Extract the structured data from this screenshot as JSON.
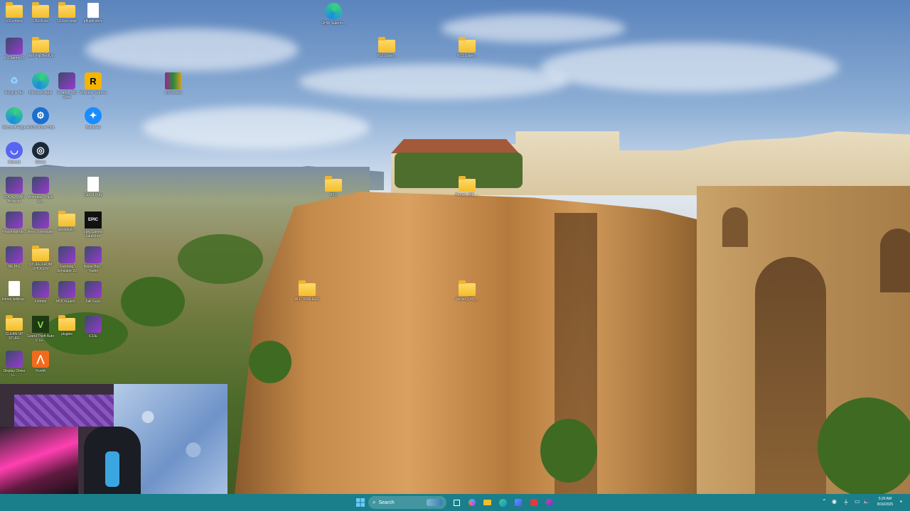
{
  "desktop": {
    "icons": [
      {
        "id": "i1",
        "label": "U1Gvnkslv",
        "kind": "folder"
      },
      {
        "id": "i2",
        "label": "U61cfcsw",
        "kind": "folder"
      },
      {
        "id": "i3",
        "label": "U13ow scipt",
        "kind": "folder"
      },
      {
        "id": "i4",
        "label": "pflugin.sbvx",
        "kind": "doc"
      },
      {
        "id": "i5",
        "label": "GHW Saterin...",
        "kind": "edge"
      },
      {
        "id": "i6",
        "label": "E-Channel 3",
        "kind": "app"
      },
      {
        "id": "i7",
        "label": "Mod Flip Bed/Up",
        "kind": "folder"
      },
      {
        "id": "i8",
        "label": "PS2 Gluen...",
        "kind": "folder"
      },
      {
        "id": "i9",
        "label": "PS3 Gluen...",
        "kind": "folder"
      },
      {
        "id": "i10",
        "label": "Recycle Bin",
        "kind": "recycle"
      },
      {
        "id": "i11",
        "label": "Microsoft Apps",
        "kind": "edge"
      },
      {
        "id": "i12",
        "label": "Smartfix 365 Store",
        "kind": "app"
      },
      {
        "id": "i13",
        "label": "Rockstar Games ...",
        "kind": "rockstar"
      },
      {
        "id": "i14",
        "label": "U1Gvnkslv",
        "kind": "winrar"
      },
      {
        "id": "i15",
        "label": "Microsoft Edge",
        "kind": "edge"
      },
      {
        "id": "i16",
        "label": "ASUS Driver Hub",
        "kind": "gear"
      },
      {
        "id": "i17",
        "label": "BattleNet",
        "kind": "battlenet"
      },
      {
        "id": "i18",
        "label": "Discord",
        "kind": "discord"
      },
      {
        "id": "i19",
        "label": "Steam",
        "kind": "steam"
      },
      {
        "id": "i20",
        "label": "LOCKDOWN Browser",
        "kind": "app"
      },
      {
        "id": "i21",
        "label": "American Truck Si...",
        "kind": "app"
      },
      {
        "id": "i22",
        "label": "Call of Duty",
        "kind": "doc"
      },
      {
        "id": "i23",
        "label": "BX2",
        "kind": "folder"
      },
      {
        "id": "i24",
        "label": "Ferrari_488_...",
        "kind": "folder"
      },
      {
        "id": "i25",
        "label": "Phasmophob...",
        "kind": "app"
      },
      {
        "id": "i26",
        "label": "Revo Uninstaller",
        "kind": "app"
      },
      {
        "id": "i27",
        "label": "derekdiph...",
        "kind": "folder"
      },
      {
        "id": "i28",
        "label": "Epic Games Launcher",
        "kind": "epic"
      },
      {
        "id": "i29",
        "label": "BE.PIG",
        "kind": "app"
      },
      {
        "id": "i30",
        "label": "STUFF FROM SHOGUN",
        "kind": "folder"
      },
      {
        "id": "i31",
        "label": "Farming Simulator 22",
        "kind": "app"
      },
      {
        "id": "i32",
        "label": "Bayer Bre... Trader",
        "kind": "app"
      },
      {
        "id": "i33",
        "label": "Inmen wildcar...",
        "kind": "doc"
      },
      {
        "id": "i34",
        "label": "Fortnite",
        "kind": "app"
      },
      {
        "id": "i35",
        "label": "MODGuard...",
        "kind": "app"
      },
      {
        "id": "i36",
        "label": "Fall Guys",
        "kind": "app"
      },
      {
        "id": "i37",
        "label": "ALL TRAILERS",
        "kind": "folder"
      },
      {
        "id": "i38",
        "label": "Ferrari_F40_...",
        "kind": "folder"
      },
      {
        "id": "i39",
        "label": "CLEAN UP STUFF",
        "kind": "folder"
      },
      {
        "id": "i40",
        "label": "Grand Theft Auto V Le...",
        "kind": "gta"
      },
      {
        "id": "i41",
        "label": "plugins",
        "kind": "folder"
      },
      {
        "id": "i42",
        "label": "iCUE",
        "kind": "app"
      },
      {
        "id": "i43",
        "label": "Display Driver U...",
        "kind": "app"
      },
      {
        "id": "i44",
        "label": "FiveM",
        "kind": "fivem"
      }
    ]
  },
  "taskbar": {
    "search_label": "Search",
    "clock_time": "5:20 AM",
    "clock_date": "8/16/2025"
  },
  "colors": {
    "taskbar": "#1a7f8a",
    "folder": "#f4be2b"
  }
}
